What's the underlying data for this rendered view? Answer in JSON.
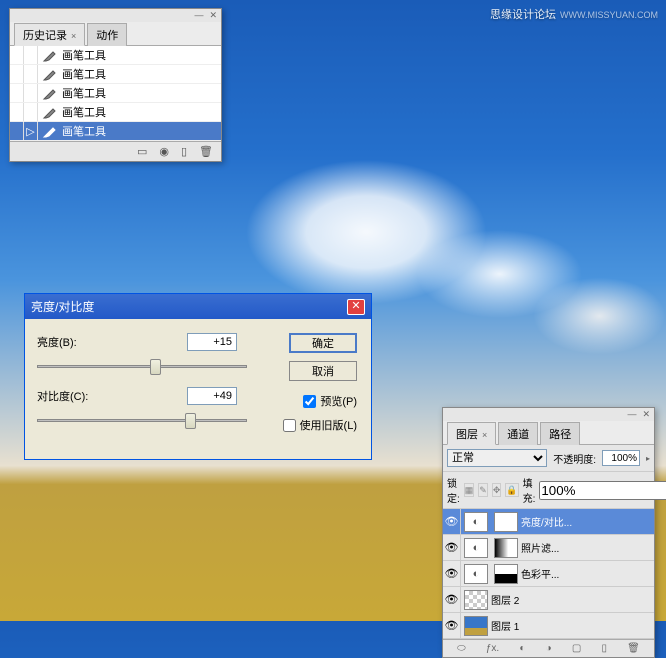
{
  "watermark": {
    "text": "思缘设计论坛",
    "url": "WWW.MISSYUAN.COM"
  },
  "history": {
    "tabs": {
      "history": "历史记录",
      "actions": "动作"
    },
    "items": [
      {
        "label": "画笔工具"
      },
      {
        "label": "画笔工具"
      },
      {
        "label": "画笔工具"
      },
      {
        "label": "画笔工具"
      },
      {
        "label": "画笔工具"
      }
    ]
  },
  "dialog": {
    "title": "亮度/对比度",
    "brightness_label": "亮度(B):",
    "brightness_value": "+15",
    "contrast_label": "对比度(C):",
    "contrast_value": "+49",
    "ok": "确定",
    "cancel": "取消",
    "preview": "预览(P)",
    "legacy": "使用旧版(L)"
  },
  "layers": {
    "tabs": {
      "layers": "图层",
      "channels": "通道",
      "paths": "路径"
    },
    "blend_mode": "正常",
    "opacity_label": "不透明度:",
    "opacity_value": "100%",
    "lock_label": "锁定:",
    "fill_label": "填充:",
    "fill_value": "100%",
    "items": [
      {
        "name": "亮度/对比...",
        "type": "adj",
        "mask": "white",
        "selected": true
      },
      {
        "name": "照片滤...",
        "type": "adj",
        "mask": "grad"
      },
      {
        "name": "色彩平...",
        "type": "adj",
        "mask": "half"
      },
      {
        "name": "图层 2",
        "type": "chk"
      },
      {
        "name": "图层 1",
        "type": "sky"
      }
    ]
  }
}
